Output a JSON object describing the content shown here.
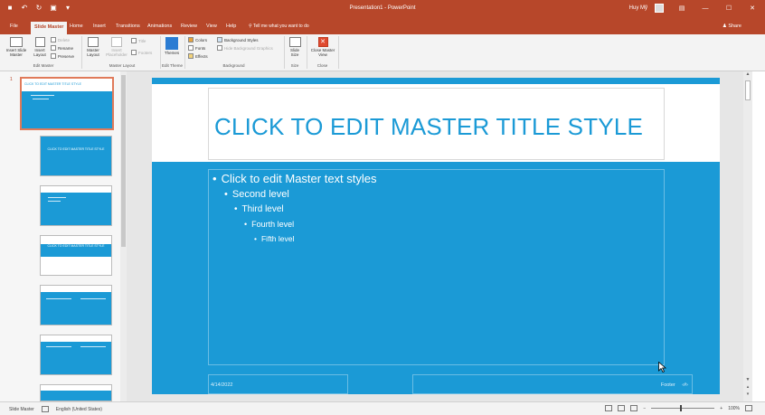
{
  "window": {
    "title": "Presentation1 - PowerPoint",
    "user": "Huy Mỹ",
    "title_bar_color": "#b7472a",
    "quick_access_icons": [
      "save-icon",
      "undo-icon",
      "redo-icon",
      "present-icon",
      "customize-icon"
    ],
    "controls": [
      "restore-ribbon-icon",
      "minimize-icon",
      "maximize-icon",
      "close-icon"
    ]
  },
  "tabs": {
    "items": [
      "File",
      "Slide Master",
      "Home",
      "Insert",
      "Transitions",
      "Animations",
      "Review",
      "View",
      "Help"
    ],
    "active": "Slide Master",
    "tell_me": "Tell me what you want to do",
    "share": "Share"
  },
  "ribbon": {
    "insert_slide_master": "Insert Slide Master",
    "insert_layout": "Insert Layout",
    "delete": "Delete",
    "rename": "Rename",
    "preserve": "Preserve",
    "master_layout": "Master Layout",
    "insert_placeholder": "Insert Placeholder",
    "title": "Title",
    "footers": "Footers",
    "themes": "Themes",
    "colors": "Colors",
    "fonts": "Fonts",
    "effects": "Effects",
    "background_styles": "Background Styles",
    "hide_background_graphics": "Hide Background Graphics",
    "slide_size": "Slide Size",
    "close_master_view": "Close Master View",
    "groups": {
      "edit_master": "Edit Master",
      "master_layout": "Master Layout",
      "edit_theme": "Edit Theme",
      "background": "Background",
      "size": "Size",
      "close": "Close"
    }
  },
  "thumbnails": {
    "master_number": "1",
    "master_title": "CLICK TO EDIT MASTER TITLE STYLE",
    "layout1_title": "CLICK TO EDIT MASTER TITLE STYLE",
    "layout3_title": "CLICK TO EDIT MASTER TITLE STYLE"
  },
  "slide": {
    "accent": "#1b9ad6",
    "title": "CLICK TO EDIT MASTER TITLE STYLE",
    "levels": [
      "Click to edit Master text styles",
      "Second level",
      "Third level",
      "Fourth level",
      "Fifth level"
    ],
    "date": "4/14/2022",
    "footer": "Footer",
    "slide_number": "‹#›"
  },
  "status": {
    "view": "Slide Master",
    "language": "English (United States)",
    "zoom": "100%"
  }
}
